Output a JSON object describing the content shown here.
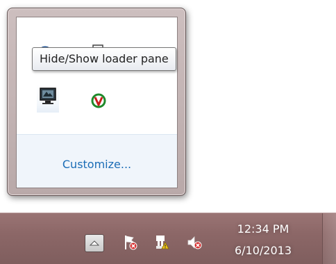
{
  "overflow_popup": {
    "tooltip": "Hide/Show loader pane",
    "customize_link": "Customize...",
    "icons": [
      "network-globe-icon",
      "document-icon",
      "red-app-icon",
      "loader-pane-monitor-icon",
      "green-v-check-icon"
    ]
  },
  "taskbar": {
    "show_hidden_icons_button_icon": "chevron-up-icon",
    "tray_icons": [
      "action-center-flag-error-icon",
      "network-warning-icon",
      "volume-muted-icon"
    ],
    "clock": {
      "time": "12:34 PM",
      "date": "6/10/2013"
    }
  },
  "colors": {
    "taskbar": "#8c6767",
    "link": "#1b6db6",
    "popup_frame": "#c4b5b5"
  }
}
